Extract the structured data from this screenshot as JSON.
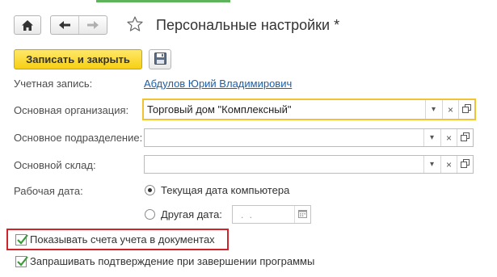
{
  "header": {
    "title": "Персональные настройки *",
    "icons": {
      "home": "home-icon",
      "back": "arrow-left-icon",
      "forward": "arrow-right-icon",
      "favorite": "star-icon"
    }
  },
  "toolbar": {
    "save_close_label": "Записать и закрыть",
    "save_icon": "floppy-disk-icon"
  },
  "form": {
    "account": {
      "label": "Учетная запись:",
      "value": "Абдулов Юрий Владимирович"
    },
    "organization": {
      "label": "Основная организация:",
      "value": "Торговый дом \"Комплексный\""
    },
    "department": {
      "label": "Основное подразделение:",
      "value": ""
    },
    "warehouse": {
      "label": "Основной склад:",
      "value": ""
    },
    "work_date": {
      "label": "Рабочая дата:",
      "options": [
        {
          "label": "Текущая дата компьютера",
          "checked": true
        },
        {
          "label": "Другая дата:",
          "checked": false
        }
      ],
      "date_value": ". ."
    },
    "field_buttons": {
      "dropdown": "▾",
      "clear": "×"
    },
    "checkboxes": [
      {
        "label": "Показывать счета учета в документах",
        "checked": true
      },
      {
        "label": "Запрашивать подтверждение при завершении программы",
        "checked": true
      }
    ]
  },
  "colors": {
    "accent_yellow": "#f7cf12",
    "focus_border": "#f1c232",
    "link": "#1c5ea8",
    "highlight_red": "#d0242b",
    "check_green": "#3a9a3a"
  }
}
